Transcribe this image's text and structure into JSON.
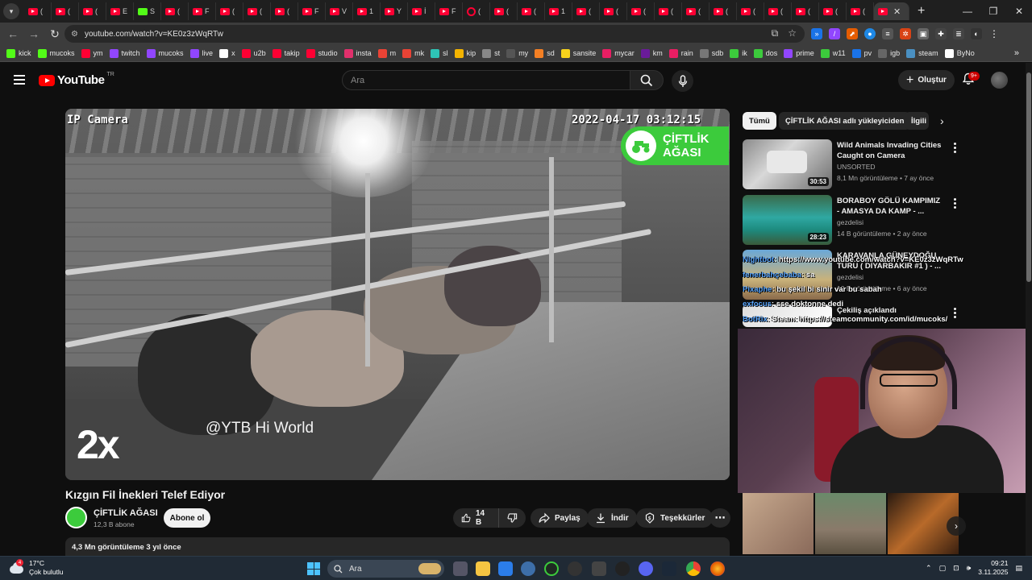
{
  "browser": {
    "url": "youtube.com/watch?v=KE0z3zWqRTw",
    "tabs": [
      {
        "label": "(",
        "icon": "youtube"
      },
      {
        "label": "(",
        "icon": "youtube"
      },
      {
        "label": "(",
        "icon": "youtube"
      },
      {
        "label": "E",
        "icon": "youtube"
      },
      {
        "label": "S",
        "icon": "kick"
      },
      {
        "label": "(",
        "icon": "youtube"
      },
      {
        "label": "F",
        "icon": "youtube"
      },
      {
        "label": "(",
        "icon": "youtube"
      },
      {
        "label": "(",
        "icon": "youtube"
      },
      {
        "label": "(",
        "icon": "youtube"
      },
      {
        "label": "F",
        "icon": "youtube"
      },
      {
        "label": "V",
        "icon": "youtube"
      },
      {
        "label": "1",
        "icon": "youtube"
      },
      {
        "label": "Y",
        "icon": "youtube"
      },
      {
        "label": "İ",
        "icon": "youtube"
      },
      {
        "label": "F",
        "icon": "youtube"
      },
      {
        "label": "(",
        "icon": "circle"
      },
      {
        "label": "(",
        "icon": "youtube"
      },
      {
        "label": "(",
        "icon": "youtube"
      },
      {
        "label": "1",
        "icon": "youtube"
      },
      {
        "label": "(",
        "icon": "youtube"
      },
      {
        "label": "(",
        "icon": "youtube"
      },
      {
        "label": "(",
        "icon": "youtube"
      },
      {
        "label": "(",
        "icon": "youtube"
      },
      {
        "label": "(",
        "icon": "youtube"
      },
      {
        "label": "(",
        "icon": "youtube"
      },
      {
        "label": "(",
        "icon": "youtube"
      },
      {
        "label": "(",
        "icon": "youtube"
      },
      {
        "label": "(",
        "icon": "youtube"
      },
      {
        "label": "(",
        "icon": "youtube"
      },
      {
        "label": "(",
        "icon": "youtube"
      }
    ],
    "active_tab_label": "(",
    "bookmarks": [
      {
        "label": "kick",
        "color": "#53fc18"
      },
      {
        "label": "mucoks",
        "color": "#53fc18"
      },
      {
        "label": "ym",
        "color": "#ff0033"
      },
      {
        "label": "twitch",
        "color": "#9146ff"
      },
      {
        "label": "mucoks",
        "color": "#9146ff"
      },
      {
        "label": "live",
        "color": "#9146ff"
      },
      {
        "label": "x",
        "color": "#ffffff"
      },
      {
        "label": "u2b",
        "color": "#ff0033"
      },
      {
        "label": "takip",
        "color": "#ff0033"
      },
      {
        "label": "studio",
        "color": "#ff0033"
      },
      {
        "label": "insta",
        "color": "#e1306c"
      },
      {
        "label": "m",
        "color": "#ea4335"
      },
      {
        "label": "mk",
        "color": "#ea4335"
      },
      {
        "label": "sl",
        "color": "#2ec4b6"
      },
      {
        "label": "kip",
        "color": "#f4b400"
      },
      {
        "label": "st",
        "color": "#888888"
      },
      {
        "label": "my",
        "color": "#555555"
      },
      {
        "label": "sd",
        "color": "#f48024"
      },
      {
        "label": "sansite",
        "color": "#f7d21c"
      },
      {
        "label": "mycar",
        "color": "#e91e63"
      },
      {
        "label": "km",
        "color": "#6a1b9a"
      },
      {
        "label": "rain",
        "color": "#e91e63"
      },
      {
        "label": "sdb",
        "color": "#777777"
      },
      {
        "label": "ik",
        "color": "#3ccb3c"
      },
      {
        "label": "dos",
        "color": "#3ccb3c"
      },
      {
        "label": "prime",
        "color": "#9146ff"
      },
      {
        "label": "w11",
        "color": "#3ccb3c"
      },
      {
        "label": "pv",
        "color": "#1a73e8"
      },
      {
        "label": "igb",
        "color": "#666666"
      },
      {
        "label": "steam",
        "color": "#4a90c2"
      },
      {
        "label": "ByNo",
        "color": "#ffffff"
      }
    ]
  },
  "youtube": {
    "logo_text": "YouTube",
    "logo_region": "TR",
    "search_placeholder": "Ara",
    "create_label": "Oluştur",
    "notification_count": "9+"
  },
  "video": {
    "title": "Kızgın Fil İnekleri Telef Ediyor",
    "overlay_cam_label": "IP Camera",
    "overlay_timestamp": "2022-04-17 03:12:15",
    "overlay_badge": [
      "ÇİFTLİK",
      "AĞASI"
    ],
    "overlay_speed": "2x",
    "overlay_watermark": "@YTB Hi World",
    "channel_name": "ÇİFTLİK AĞASI",
    "subscribers": "12,3 B abone",
    "subscribe_label": "Abone ol",
    "likes": "14 B",
    "share_label": "Paylaş",
    "download_label": "İndir",
    "thanks_label": "Teşekkürler",
    "views_and_date": "4,3 Mn görüntüleme  3 yıl önce"
  },
  "sidebar": {
    "chips": [
      "Tümü",
      "ÇİFTLİK AĞASI adlı yükleyiciden",
      "İlgili"
    ],
    "recommendations": [
      {
        "title": "Wild Animals Invading Cities Caught on Camera",
        "channel": "UNSORTED",
        "meta": "8,1 Mn görüntüleme • 7 ay önce",
        "duration": "30:53"
      },
      {
        "title": "BORABOY GÖLÜ KAMPIMIZ - AMASYA DA KAMP - ...",
        "channel": "gezdelisi",
        "meta": "14 B görüntüleme • 2 ay önce",
        "duration": "28:23"
      },
      {
        "title": "KARAVANLA GÜNEYDOĞU TURU ( DİYARBAKIR #1 ) - ...",
        "channel": "gezdelisi",
        "meta": "10 B görüntüleme • 6 ay önce",
        "duration": ""
      },
      {
        "title": "Çekiliş açıklandı",
        "channel": "",
        "meta": "",
        "duration": ""
      }
    ]
  },
  "chat": [
    {
      "user": "Nightbot",
      "text": ": https://www.youtube.com/watch?v=KE0z3zWqRTw"
    },
    {
      "user": "fenerbahçebaba",
      "text": ": sa"
    },
    {
      "user": "Pixaphe",
      "text": ": bu şekil bi sinir var bu sabah"
    },
    {
      "user": "exfocus",
      "text": ": sse doktonne dedi"
    },
    {
      "user": "BotRix",
      "text": ": Steam: https://steamcommunity.com/id/mucoks/"
    }
  ],
  "taskbar": {
    "temperature": "17°C",
    "weather": "Çok bulutlu",
    "weather_badge": "4",
    "search_label": "Ara",
    "time": "09:21",
    "date": "3.11.2025"
  },
  "colors": {
    "youtube_red": "#ff0000",
    "channel_green": "#3ccb3c",
    "background": "#0f0f0f"
  }
}
